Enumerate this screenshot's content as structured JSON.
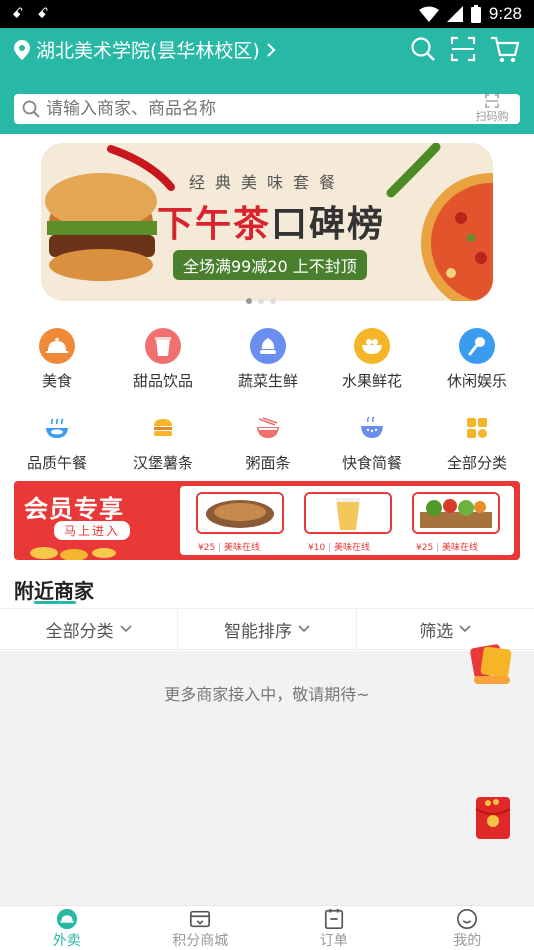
{
  "status_bar": {
    "time": "9:28"
  },
  "header": {
    "location": "湖北美术学院(昙华林校区)",
    "search_placeholder": "请输入商家、商品名称",
    "scan_buy_label": "扫码购"
  },
  "banner": {
    "subtitle": "经典美味套餐",
    "title_red": "下午茶",
    "title_dark": "口碑榜",
    "promo": "全场满99减20 上不封顶"
  },
  "categories": [
    {
      "label": "美食",
      "icon": "food-cover-icon",
      "color": "#f08a3a"
    },
    {
      "label": "甜品饮品",
      "icon": "drink-cup-icon",
      "color": "#f07070"
    },
    {
      "label": "蔬菜生鲜",
      "icon": "vegetable-icon",
      "color": "#6a8ef0"
    },
    {
      "label": "水果鲜花",
      "icon": "fruit-bowl-icon",
      "color": "#f5b526"
    },
    {
      "label": "休闲娱乐",
      "icon": "microphone-icon",
      "color": "#3a9cf0"
    },
    {
      "label": "品质午餐",
      "icon": "lunch-icon",
      "color": "#3a9cf0"
    },
    {
      "label": "汉堡薯条",
      "icon": "burger-icon",
      "color": "#f5b526"
    },
    {
      "label": "粥面条",
      "icon": "noodle-bowl-icon",
      "color": "#f07070"
    },
    {
      "label": "快食简餐",
      "icon": "rice-bowl-icon",
      "color": "#6a8ef0"
    },
    {
      "label": "全部分类",
      "icon": "all-categories-icon",
      "color": "#f5b526"
    }
  ],
  "member_banner": {
    "title": "会员专享",
    "enter_label": "马上进入",
    "items": [
      {
        "price": "¥25",
        "brand": "美味在线"
      },
      {
        "price": "¥10",
        "brand": "美味在线"
      },
      {
        "price": "¥25",
        "brand": "美味在线"
      }
    ]
  },
  "nearby": {
    "title": "附近商家",
    "filters": [
      "全部分类",
      "智能排序",
      "筛选"
    ],
    "empty_text": "更多商家接入中，敬请期待~"
  },
  "tabs": [
    {
      "label": "外卖",
      "icon": "takeout-icon",
      "active": true
    },
    {
      "label": "积分商城",
      "icon": "points-mall-icon",
      "active": false
    },
    {
      "label": "订单",
      "icon": "order-icon",
      "active": false
    },
    {
      "label": "我的",
      "icon": "profile-icon",
      "active": false
    }
  ],
  "colors": {
    "primary": "#28b8a6",
    "accent_red": "#e83838"
  }
}
